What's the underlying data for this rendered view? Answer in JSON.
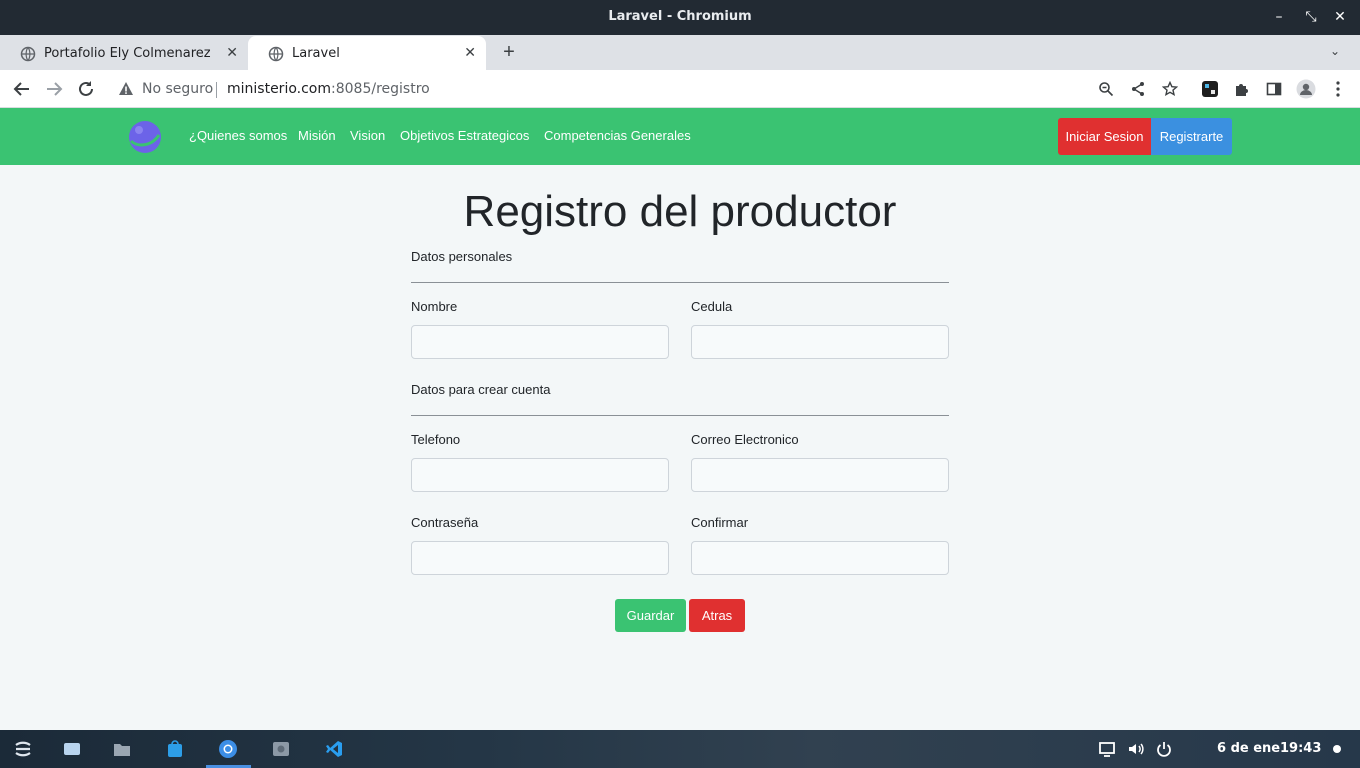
{
  "window": {
    "title": "Laravel - Chromium",
    "minimize": "–",
    "restore": "⤡",
    "close": "✕"
  },
  "tabs": [
    {
      "label": "Portafolio Ely Colmenarez",
      "close": "✕"
    },
    {
      "label": "Laravel",
      "close": "✕"
    }
  ],
  "new_tab": "+",
  "tab_menu": "⌄",
  "address": {
    "security_text": "No seguro",
    "host": "ministerio.com",
    "rest": ":8085/registro"
  },
  "site_nav": {
    "links": [
      "¿Quienes somos",
      "Misión",
      "Vision",
      "Objetivos Estrategicos",
      "Competencias Generales"
    ],
    "login_button": "Iniciar Sesion",
    "register_button": "Registrarte"
  },
  "form": {
    "title": "Registro del productor",
    "section_personal": "Datos personales",
    "name_label": "Nombre",
    "id_label": "Cedula",
    "section_account": "Datos para crear cuenta",
    "phone_label": "Telefono",
    "email_label": "Correo Electronico",
    "password_label": "Contraseña",
    "confirm_label": "Confirmar",
    "save_button": "Guardar",
    "back_button": "Atras"
  },
  "taskbar": {
    "date": "6 de ene",
    "time": "19:43"
  },
  "colors": {
    "navbar": "#3ac372",
    "danger": "#e03030",
    "primary": "#3b90e0"
  }
}
